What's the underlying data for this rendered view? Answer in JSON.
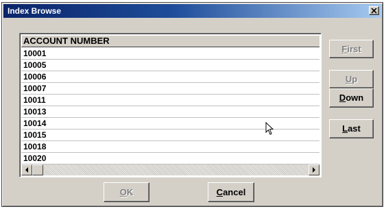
{
  "window": {
    "title": "Index Browse",
    "close_label": "✕"
  },
  "list": {
    "header": "ACCOUNT NUMBER",
    "rows": [
      "10001",
      "10005",
      "10006",
      "10007",
      "10011",
      "10013",
      "10014",
      "10015",
      "10018",
      "10020"
    ]
  },
  "buttons": {
    "first": {
      "label": "First",
      "hotkey": "F",
      "rest": "irst",
      "enabled": false
    },
    "up": {
      "label": "Up",
      "hotkey": "U",
      "rest": "p",
      "enabled": false
    },
    "down": {
      "label": "Down",
      "hotkey": "D",
      "rest": "own",
      "enabled": true
    },
    "last": {
      "label": "Last",
      "hotkey": "L",
      "rest": "ast",
      "enabled": true
    },
    "ok": {
      "label": "OK",
      "hotkey": "O",
      "rest": "K",
      "enabled": false
    },
    "cancel": {
      "label": "Cancel",
      "hotkey": "C",
      "rest": "ancel",
      "enabled": true
    }
  },
  "icons": {
    "close": "close-icon",
    "scroll_left": "arrow-left-icon",
    "scroll_right": "arrow-right-icon",
    "pointer": "mouse-pointer-icon"
  },
  "colors": {
    "titlebar_start": "#0a246a",
    "titlebar_end": "#a6caf0",
    "face": "#d4d0c8",
    "disabled_text": "#808080"
  }
}
